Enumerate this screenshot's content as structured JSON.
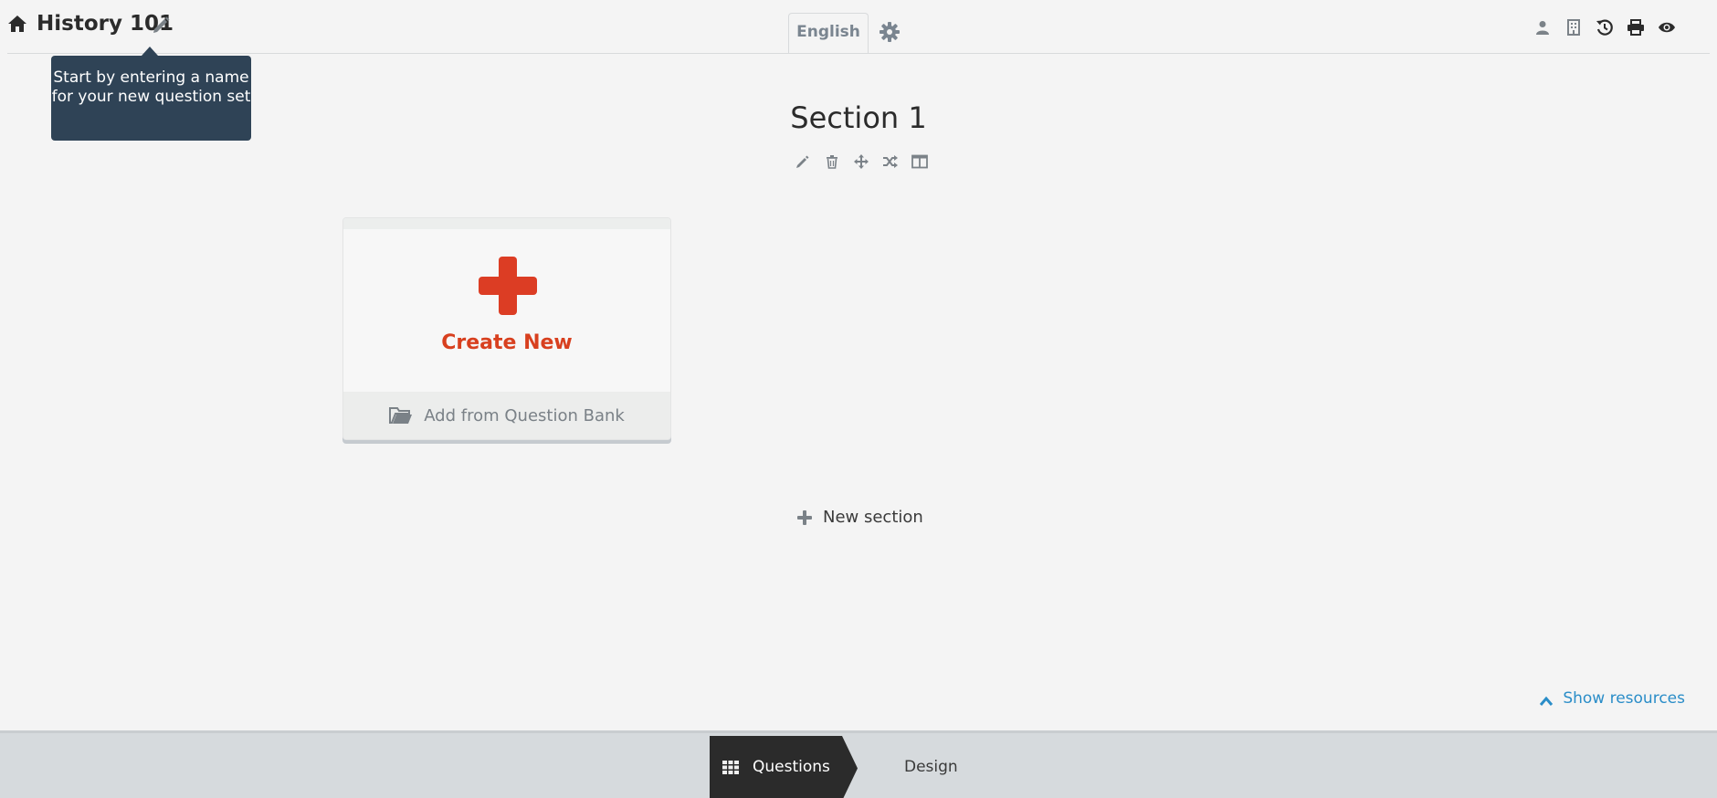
{
  "header": {
    "title": "History 101",
    "language_tab": "English",
    "icons": [
      "home-icon",
      "pencil-icon",
      "gear-icon",
      "user-icon",
      "building-icon",
      "history-icon",
      "print-icon",
      "eye-icon"
    ]
  },
  "tooltip": {
    "text": "Start by entering a name for your new question set"
  },
  "section": {
    "title": "Section 1",
    "tools": [
      "pencil-icon",
      "trash-icon",
      "move-icon",
      "shuffle-icon",
      "columns-icon"
    ]
  },
  "card": {
    "create_label": "Create New",
    "bank_label": "Add from Question Bank"
  },
  "new_section": {
    "label": "New section"
  },
  "resources": {
    "label": "Show resources"
  },
  "steps": {
    "questions_label": "Questions",
    "design_label": "Design"
  },
  "colors": {
    "accent_red": "#dc3d24",
    "link_blue": "#2a8dc8",
    "tooltip_bg": "#2f4356",
    "step_active_bg": "#2b2b2b"
  }
}
